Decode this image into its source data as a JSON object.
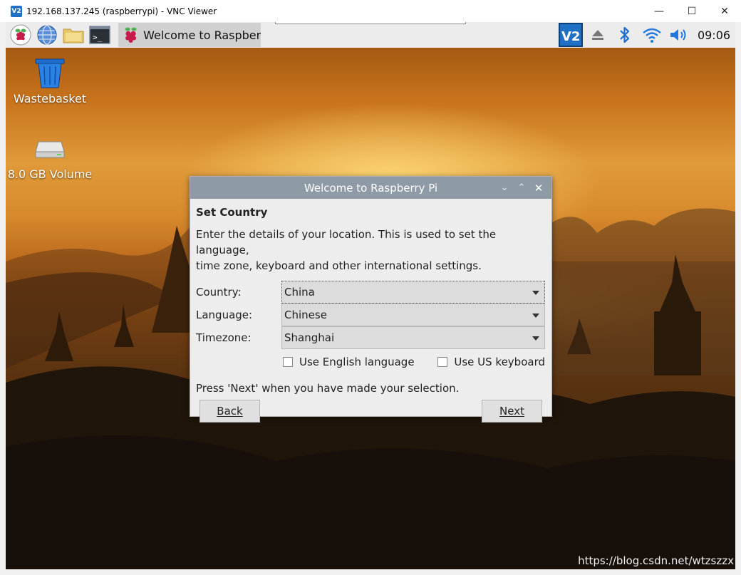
{
  "window": {
    "icon_text": "V2",
    "title": "192.168.137.245 (raspberrypi) - VNC Viewer",
    "minimize": "—",
    "maximize": "☐",
    "close": "✕"
  },
  "taskbar": {
    "active_task_label": "Welcome to Raspberr...",
    "clock": "09:06"
  },
  "desktop": {
    "icons": [
      {
        "label": "Wastebasket"
      },
      {
        "label": "8.0 GB Volume"
      }
    ],
    "watermark": "https://blog.csdn.net/wtzszzx"
  },
  "dialog": {
    "title": "Welcome to Raspberry Pi",
    "heading": "Set Country",
    "description_line1": "Enter the details of your location. This is used to set the language,",
    "description_line2": "time zone, keyboard and other international settings.",
    "fields": {
      "country": {
        "label": "Country:",
        "value": "China"
      },
      "language": {
        "label": "Language:",
        "value": "Chinese"
      },
      "timezone": {
        "label": "Timezone:",
        "value": "Shanghai"
      }
    },
    "checkboxes": {
      "english": {
        "label": "Use English language",
        "checked": false
      },
      "us_keyboard": {
        "label": "Use US keyboard",
        "checked": false
      }
    },
    "hint": "Press 'Next' when you have made your selection.",
    "back_label": "Back",
    "next_label": "Next"
  },
  "colors": {
    "dialog_titlebar": "#8e9aa6",
    "taskbar": "#ececec",
    "vnc_tray": "#1f6fc5"
  }
}
